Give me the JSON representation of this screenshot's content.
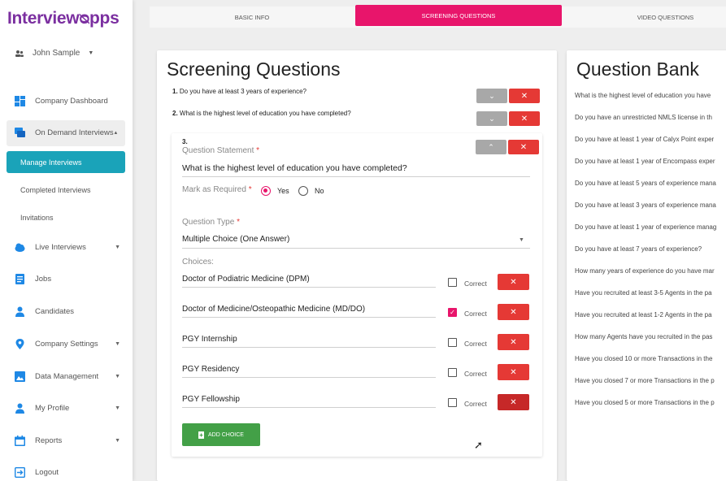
{
  "brand": {
    "logo_part1": "Interview",
    "logo_part2": "ᴓpps",
    "color": "#7b2fa0"
  },
  "user": {
    "name": "John Sample"
  },
  "sidebar": {
    "items": [
      {
        "label": "Company Dashboard",
        "icon": "dashboard-icon"
      },
      {
        "label": "On Demand Interviews",
        "icon": "interviews-icon"
      },
      {
        "label": "Live Interviews",
        "icon": "cloud-icon"
      },
      {
        "label": "Jobs",
        "icon": "jobs-icon"
      },
      {
        "label": "Candidates",
        "icon": "person-icon"
      },
      {
        "label": "Company Settings",
        "icon": "location-icon"
      },
      {
        "label": "Data Management",
        "icon": "image-icon"
      },
      {
        "label": "My Profile",
        "icon": "person-icon"
      },
      {
        "label": "Reports",
        "icon": "calendar-icon"
      },
      {
        "label": "Logout",
        "icon": "logout-icon"
      }
    ],
    "submenu": [
      "Manage Interviews",
      "Completed Interviews",
      "Invitations"
    ]
  },
  "tabs": [
    "BASIC INFO",
    "SCREENING QUESTIONS",
    "VIDEO QUESTIONS"
  ],
  "screening": {
    "title": "Screening Questions",
    "q1": {
      "num": "1.",
      "text": "Do you have at least 3 years of experience?"
    },
    "q2": {
      "num": "2.",
      "text": "What is the highest level of education you have completed?"
    },
    "q3": {
      "num": "3.",
      "statement_label": "Question Statement",
      "statement": "What is the highest level of education you have completed?",
      "required_label": "Mark as Required",
      "yes": "Yes",
      "no": "No",
      "type_label": "Question Type",
      "type": "Multiple Choice (One Answer)",
      "choices_label": "Choices:",
      "correct_label": "Correct",
      "choices": [
        "Doctor of Podiatric Medicine (DPM)",
        "Doctor of Medicine/Osteopathic Medicine (MD/DO)",
        "PGY Internship",
        "PGY Residency",
        "PGY Fellowship"
      ],
      "add_choice": "ADD CHOICE"
    },
    "req_mark": "*",
    "expand": "⌄",
    "collapse": "⌃",
    "delete": "✕"
  },
  "question_bank": {
    "title": "Question Bank",
    "items": [
      "What is the highest level of education you have",
      "Do you have an unrestricted NMLS license in th",
      "Do you have at least 1 year of Calyx Point exper",
      "Do you have at least 1 year of Encompass exper",
      "Do you have at least 5 years of experience mana",
      "Do you have at least 3 years of experience mana",
      "Do you have at least 1 year of experience manag",
      "Do you have at least 7 years of experience?",
      "How many years of experience do you have mar",
      "Have you recruited at least 3-5 Agents in the pa",
      "Have you recruited at least 1-2 Agents in the pa",
      "How many Agents have you recruited in the pas",
      "Have you closed 10 or more Transactions in the",
      "Have you closed 7 or more Transactions in the p",
      "Have you closed 5 or more Transactions in the p"
    ]
  }
}
